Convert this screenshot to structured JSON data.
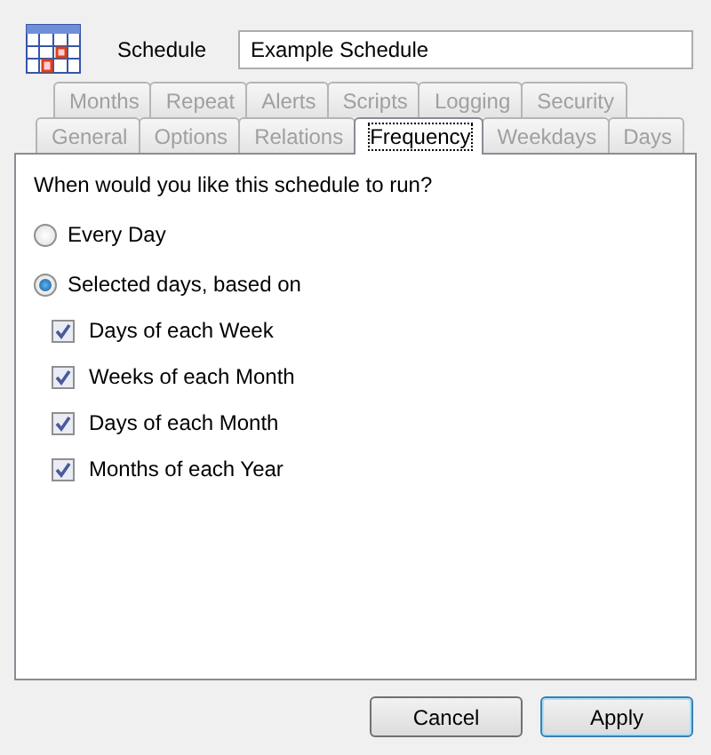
{
  "header": {
    "label": "Schedule",
    "name_value": "Example Schedule"
  },
  "tab_rows": [
    [
      {
        "label": "Months",
        "selected": false
      },
      {
        "label": "Repeat",
        "selected": false
      },
      {
        "label": "Alerts",
        "selected": false
      },
      {
        "label": "Scripts",
        "selected": false
      },
      {
        "label": "Logging",
        "selected": false
      },
      {
        "label": "Security",
        "selected": false
      }
    ],
    [
      {
        "label": "General",
        "selected": false
      },
      {
        "label": "Options",
        "selected": false
      },
      {
        "label": "Relations",
        "selected": false
      },
      {
        "label": "Frequency",
        "selected": true
      },
      {
        "label": "Weekdays",
        "selected": false
      },
      {
        "label": "Days",
        "selected": false
      }
    ]
  ],
  "question": "When would you like this schedule to run?",
  "options": [
    {
      "label": "Every Day",
      "selected": false
    },
    {
      "label": "Selected days, based on",
      "selected": true
    }
  ],
  "checkboxes": [
    {
      "label": "Days of each Week",
      "checked": true
    },
    {
      "label": "Weeks of each Month",
      "checked": true
    },
    {
      "label": "Days of each Month",
      "checked": true
    },
    {
      "label": "Months of each Year",
      "checked": true
    }
  ],
  "buttons": [
    {
      "label": "Cancel",
      "default": false
    },
    {
      "label": "Apply",
      "default": true
    }
  ]
}
